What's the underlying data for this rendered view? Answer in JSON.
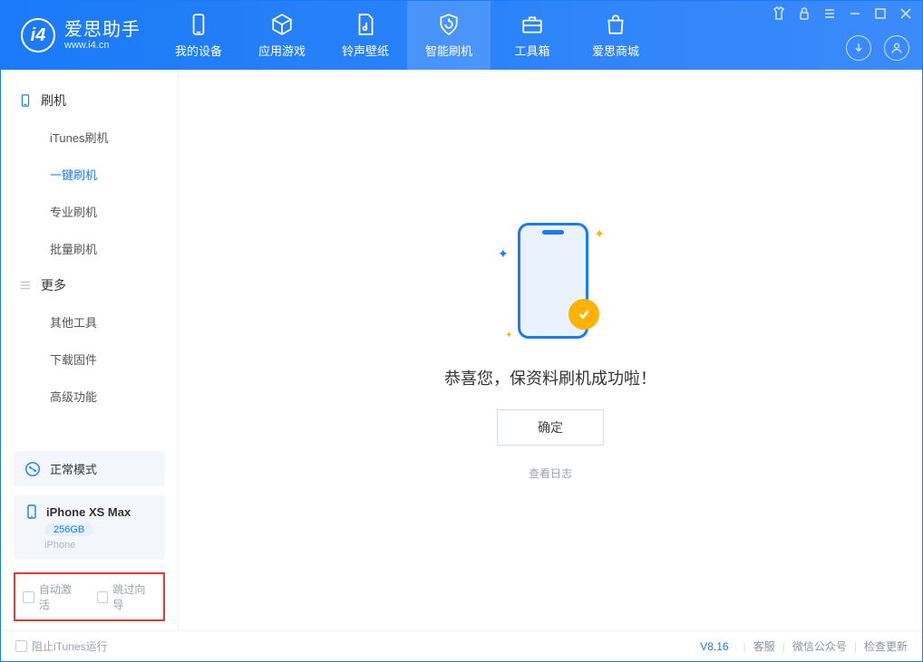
{
  "app": {
    "name_cn": "爱思助手",
    "name_en": "www.i4.cn"
  },
  "tabs": [
    {
      "label": "我的设备"
    },
    {
      "label": "应用游戏"
    },
    {
      "label": "铃声壁纸"
    },
    {
      "label": "智能刷机"
    },
    {
      "label": "工具箱"
    },
    {
      "label": "爱思商城"
    }
  ],
  "sidebar": {
    "group1": {
      "title": "刷机",
      "items": [
        "iTunes刷机",
        "一键刷机",
        "专业刷机",
        "批量刷机"
      ]
    },
    "group2": {
      "title": "更多",
      "items": [
        "其他工具",
        "下载固件",
        "高级功能"
      ]
    }
  },
  "mode": {
    "label": "正常模式"
  },
  "device": {
    "name": "iPhone XS Max",
    "capacity": "256GB",
    "type": "iPhone"
  },
  "options": {
    "auto_activate": "自动激活",
    "skip_guide": "跳过向导"
  },
  "main": {
    "success_msg": "恭喜您，保资料刷机成功啦！",
    "ok_label": "确定",
    "log_link": "查看日志"
  },
  "footer": {
    "block_itunes": "阻止iTunes运行",
    "version": "V8.16",
    "links": [
      "客服",
      "微信公众号",
      "检查更新"
    ]
  }
}
